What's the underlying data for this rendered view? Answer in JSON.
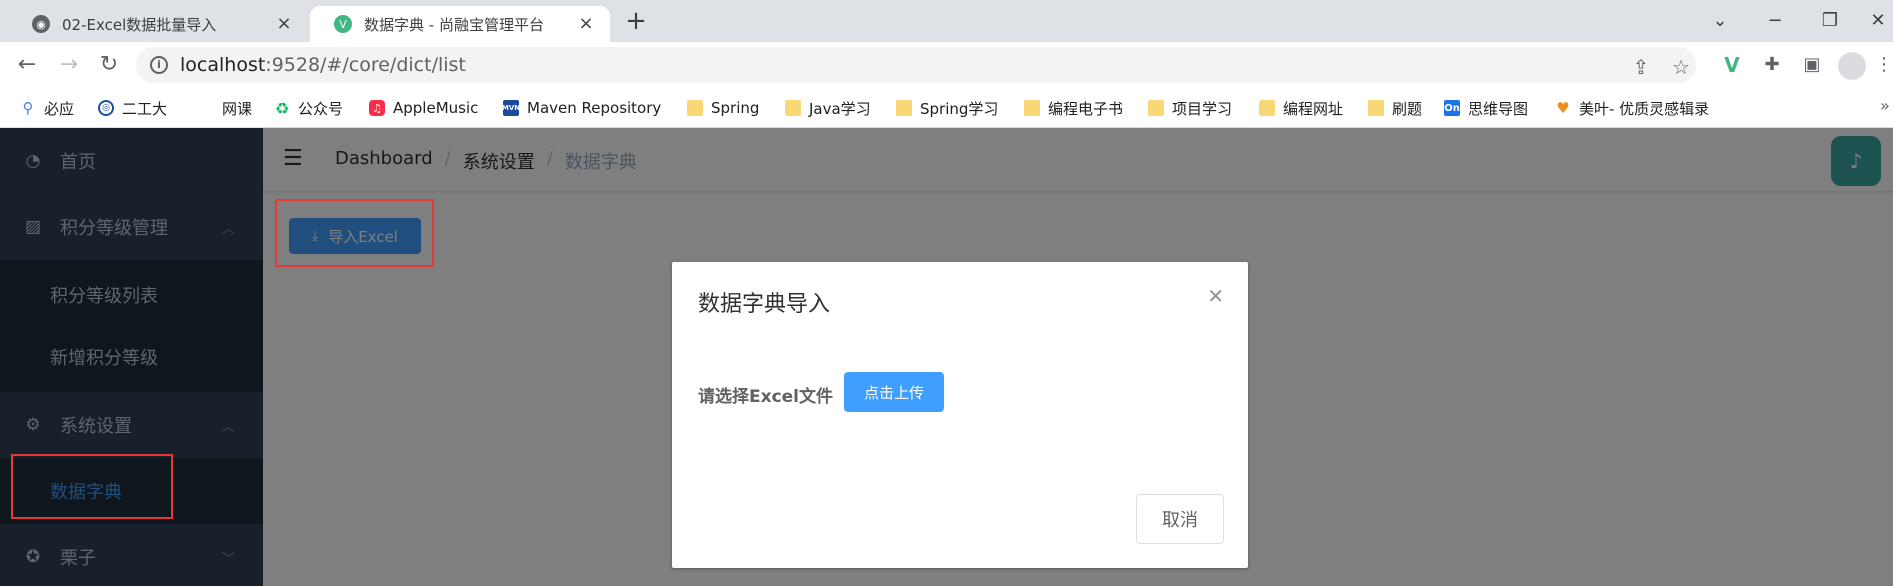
{
  "browser": {
    "tabs": [
      {
        "title": "02-Excel数据批量导入",
        "active": false
      },
      {
        "title": "数据字典 - 尚融宝管理平台",
        "active": true
      }
    ],
    "url_host": "localhost",
    "url_path": ":9528/#/core/dict/list",
    "bookmarks": [
      {
        "label": "必应",
        "icon": "search-icon"
      },
      {
        "label": "二工大",
        "icon": "badge-icon"
      },
      {
        "label": "网课",
        "icon": "none"
      },
      {
        "label": "公众号",
        "icon": "wechat-icon"
      },
      {
        "label": "AppleMusic",
        "icon": "music-icon"
      },
      {
        "label": "Maven Repository",
        "icon": "mvn-icon"
      },
      {
        "label": "Spring",
        "icon": "folder-icon"
      },
      {
        "label": "Java学习",
        "icon": "folder-icon"
      },
      {
        "label": "Spring学习",
        "icon": "folder-icon"
      },
      {
        "label": "编程电子书",
        "icon": "folder-icon"
      },
      {
        "label": "项目学习",
        "icon": "folder-icon"
      },
      {
        "label": "编程网址",
        "icon": "folder-icon"
      },
      {
        "label": "刷题",
        "icon": "folder-icon"
      },
      {
        "label": "思维导图",
        "icon": "on-icon"
      },
      {
        "label": "美叶- 优质灵感辑录",
        "icon": "leaf-icon"
      }
    ]
  },
  "sidebar": {
    "home": "首页",
    "level_menu": "积分等级管理",
    "level_list": "积分等级列表",
    "level_add": "新增积分等级",
    "system_menu": "系统设置",
    "dict": "数据字典",
    "demo": "栗子"
  },
  "breadcrumb": [
    "Dashboard",
    "系统设置",
    "数据字典"
  ],
  "toolbar": {
    "import_label": "导入Excel"
  },
  "dialog": {
    "title": "数据字典导入",
    "label": "请选择Excel文件",
    "upload_label": "点击上传",
    "cancel_label": "取消"
  },
  "colors": {
    "primary": "#409eff",
    "sidebar_bg": "#304156",
    "annotation": "#e53935"
  }
}
